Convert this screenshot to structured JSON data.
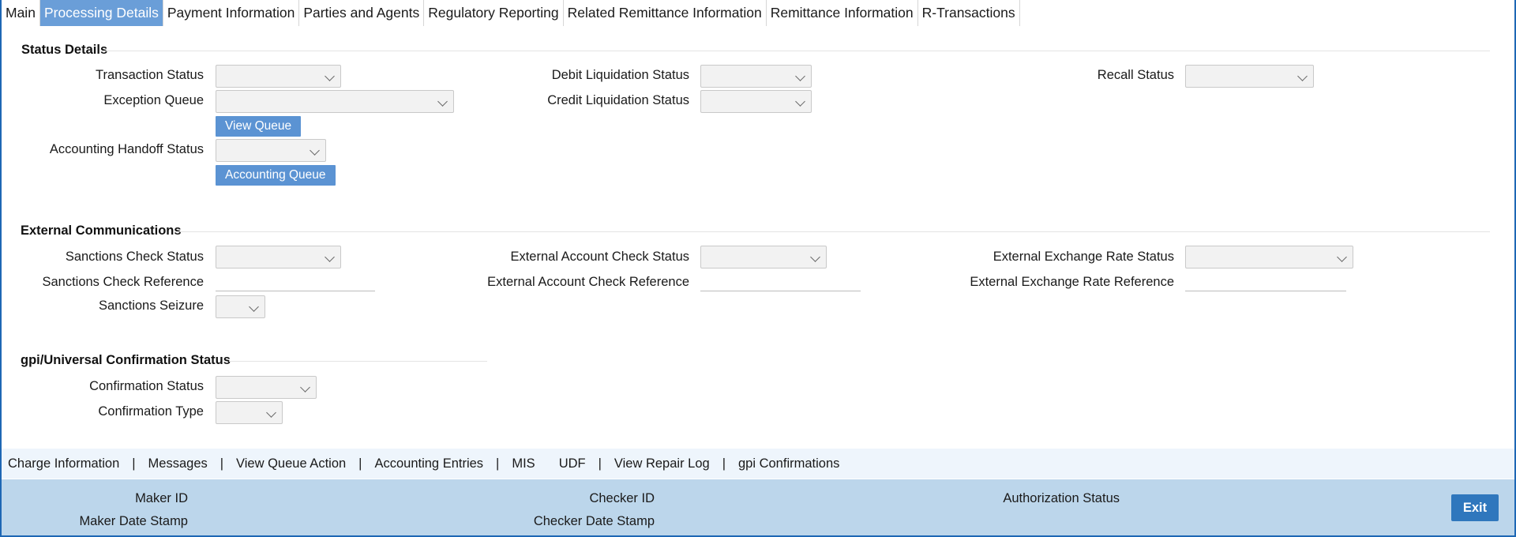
{
  "tabs": [
    {
      "label": "Main"
    },
    {
      "label": "Processing Details"
    },
    {
      "label": "Payment Information"
    },
    {
      "label": "Parties and Agents"
    },
    {
      "label": "Regulatory Reporting"
    },
    {
      "label": "Related Remittance Information"
    },
    {
      "label": "Remittance Information"
    },
    {
      "label": "R-Transactions"
    }
  ],
  "active_tab": "Processing Details",
  "status_details": {
    "title": "Status Details",
    "transaction_status_label": "Transaction Status",
    "exception_queue_label": "Exception Queue",
    "view_queue_button": "View Queue",
    "accounting_handoff_status_label": "Accounting Handoff Status",
    "accounting_queue_button": "Accounting Queue",
    "debit_liquidation_status_label": "Debit Liquidation Status",
    "credit_liquidation_status_label": "Credit Liquidation Status",
    "recall_status_label": "Recall Status"
  },
  "external_communications": {
    "title": "External Communications",
    "sanctions_check_status_label": "Sanctions Check Status",
    "sanctions_check_reference_label": "Sanctions Check Reference",
    "sanctions_seizure_label": "Sanctions Seizure",
    "external_account_check_status_label": "External Account Check Status",
    "external_account_check_reference_label": "External Account Check Reference",
    "external_exchange_rate_status_label": "External Exchange Rate Status",
    "external_exchange_rate_reference_label": "External Exchange Rate Reference"
  },
  "gpi": {
    "title": "gpi/Universal Confirmation Status",
    "confirmation_status_label": "Confirmation Status",
    "confirmation_type_label": "Confirmation Type"
  },
  "bottom_links": [
    {
      "label": "Charge Information"
    },
    {
      "label": "Messages"
    },
    {
      "label": "View Queue Action"
    },
    {
      "label": "Accounting Entries"
    },
    {
      "label": "MIS"
    },
    {
      "label": "UDF"
    },
    {
      "label": "View Repair Log"
    },
    {
      "label": "gpi Confirmations"
    }
  ],
  "footer": {
    "maker_id_label": "Maker ID",
    "maker_date_stamp_label": "Maker Date Stamp",
    "checker_id_label": "Checker ID",
    "checker_date_stamp_label": "Checker Date Stamp",
    "authorization_status_label": "Authorization Status",
    "exit_button": "Exit"
  },
  "colors": {
    "active_tab": "#6a9ed8",
    "button": "#5b93d3",
    "footer_bg": "#bcd6eb",
    "links_bg": "#eef5fc",
    "exit_button": "#2f77bd",
    "frame_border": "#1e67b4"
  },
  "icons": {
    "dropdown": "chevron-down-icon"
  }
}
